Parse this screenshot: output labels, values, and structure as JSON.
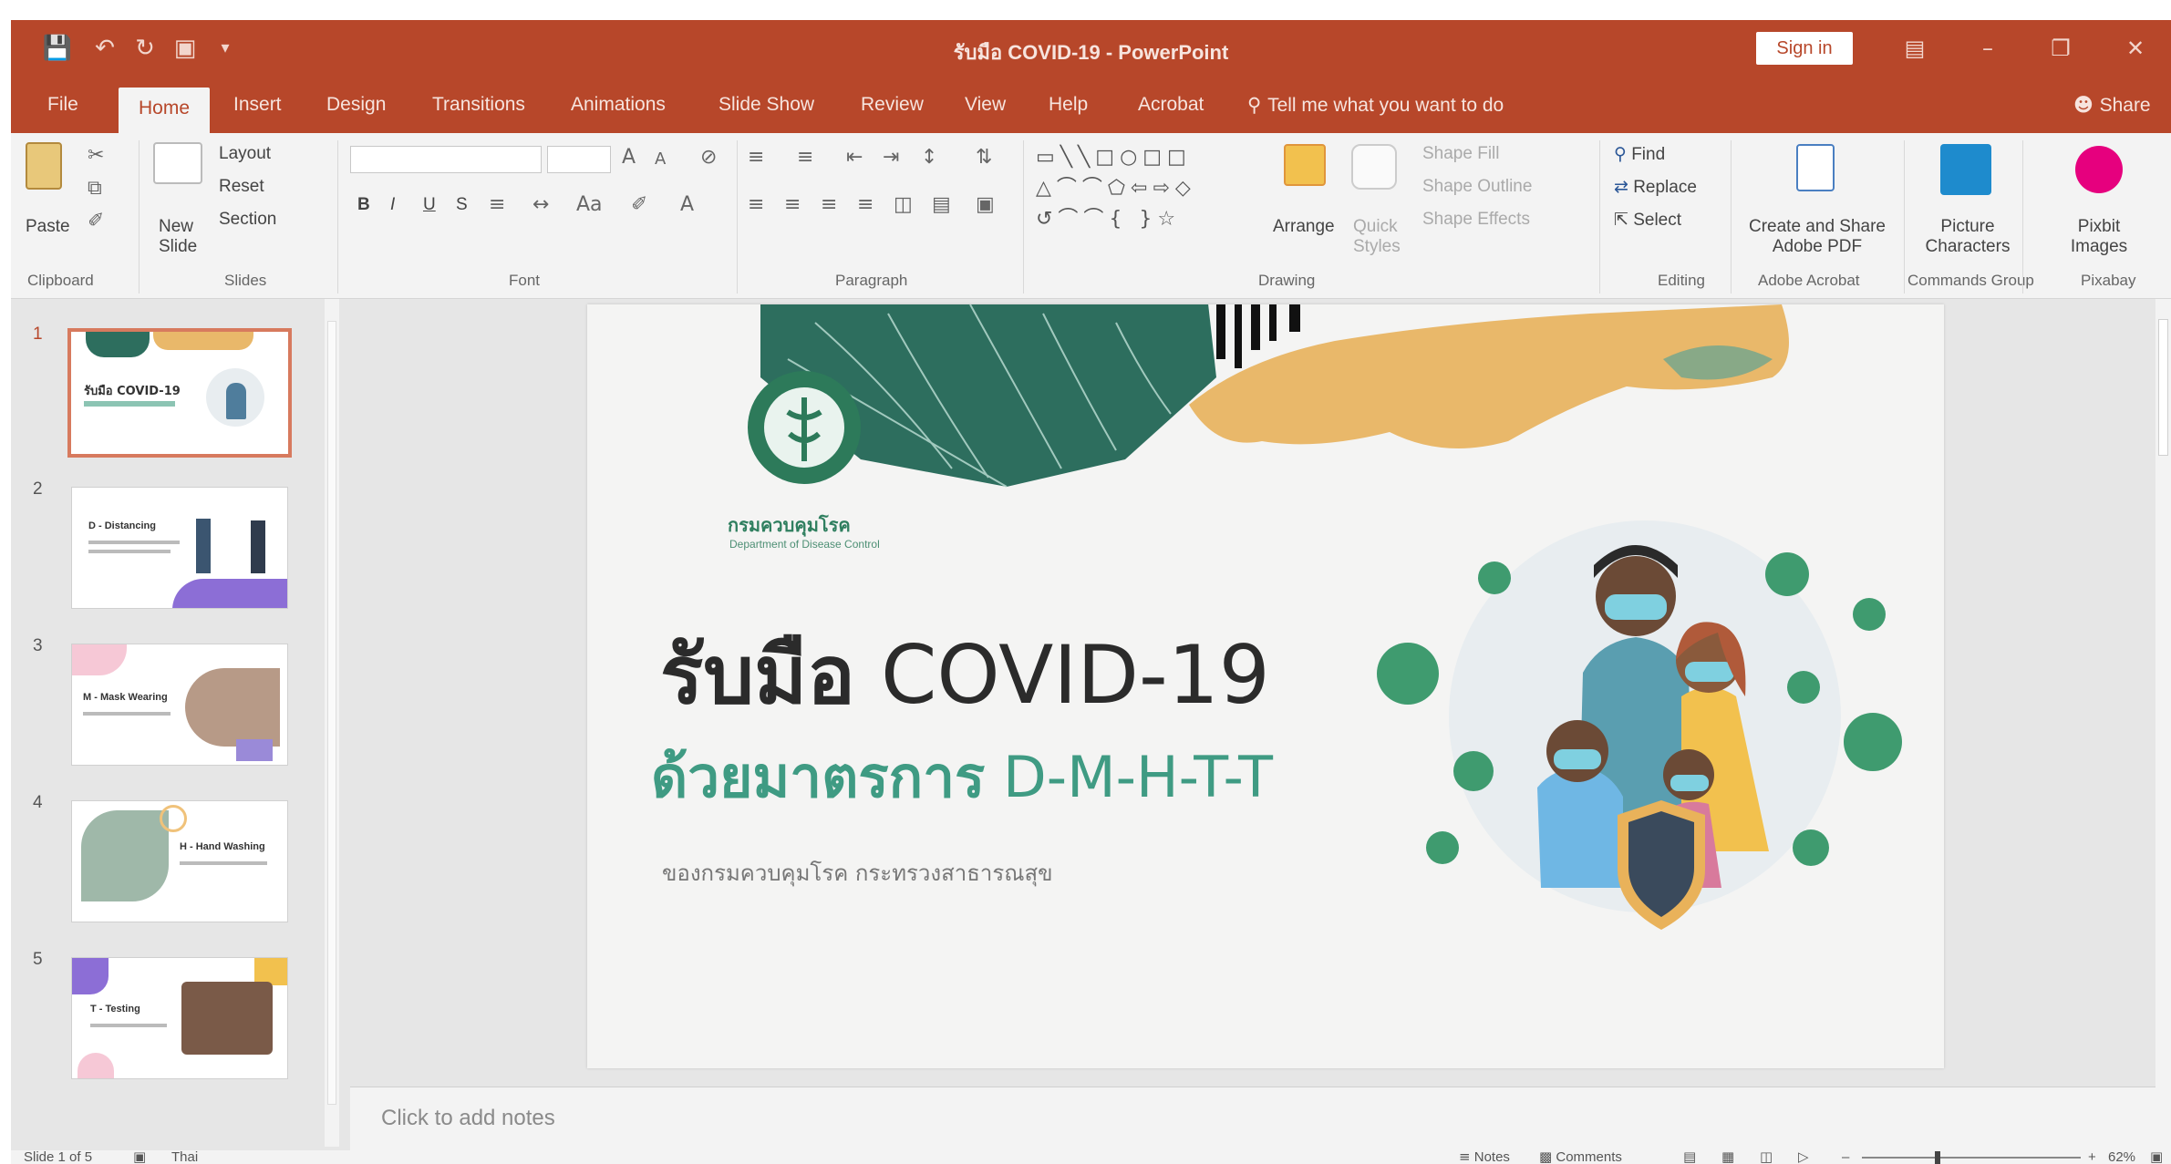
{
  "window": {
    "title": "รับมือ COVID-19 - PowerPoint",
    "sign_in": "Sign in",
    "qat_icons": [
      "save-icon",
      "undo-icon",
      "redo-icon",
      "start-from-beginning-icon",
      "customize-qat-icon"
    ]
  },
  "tabs": [
    {
      "label": "File"
    },
    {
      "label": "Home"
    },
    {
      "label": "Insert"
    },
    {
      "label": "Design"
    },
    {
      "label": "Transitions"
    },
    {
      "label": "Animations"
    },
    {
      "label": "Slide Show"
    },
    {
      "label": "Review"
    },
    {
      "label": "View"
    },
    {
      "label": "Help"
    },
    {
      "label": "Acrobat"
    }
  ],
  "tell_me": "Tell me what you want to do",
  "share": "Share",
  "ribbon": {
    "clipboard": {
      "label": "Clipboard",
      "paste": "Paste"
    },
    "slides": {
      "label": "Slides",
      "new_slide": "New Slide",
      "layout": "Layout",
      "reset": "Reset",
      "section": "Section"
    },
    "font": {
      "label": "Font",
      "bold": "B",
      "italic": "I",
      "underline": "U",
      "shadow": "S"
    },
    "paragraph": {
      "label": "Paragraph"
    },
    "drawing": {
      "label": "Drawing",
      "arrange": "Arrange",
      "quick_styles": "Quick Styles",
      "shape_fill": "Shape Fill",
      "shape_outline": "Shape Outline",
      "shape_effects": "Shape Effects"
    },
    "editing": {
      "label": "Editing",
      "find": "Find",
      "replace": "Replace",
      "select": "Select"
    },
    "adobe": {
      "label": "Adobe Acrobat",
      "create_share": "Create and Share Adobe PDF"
    },
    "commands_group": {
      "label": "Commands Group",
      "picture_characters": "Picture Characters"
    },
    "pixabay": {
      "label": "Pixabay",
      "pixabay_images": "Pixbit Images"
    }
  },
  "thumbnails": [
    {
      "num": "1",
      "title": "รับมือ COVID-19"
    },
    {
      "num": "2",
      "title": "D - Distancing"
    },
    {
      "num": "3",
      "title": "M - Mask Wearing"
    },
    {
      "num": "4",
      "title": "H - Hand Washing"
    },
    {
      "num": "5",
      "title": "T - Testing"
    }
  ],
  "slide": {
    "title_thai": "รับมือ",
    "title_latin": " COVID-19",
    "subtitle_thai": "ด้วยมาตรการ",
    "subtitle_latin": " D-M-H-T-T",
    "caption": "ของกรมควบคุมโรค กระทรวงสาธารณสุข",
    "dept_name": "กรมควบคุมโรค",
    "dept_name_en": "Department of Disease Control"
  },
  "notes_placeholder": "Click to add notes",
  "status": {
    "slide_info": "Slide 1 of 5",
    "language": "Thai",
    "notes": "Notes",
    "comments": "Comments",
    "zoom": "62%"
  },
  "colors": {
    "accent": "#b7472a",
    "slide_green": "#3f9b83",
    "dark_green": "#2d6e5e",
    "sand": "#e9b86a"
  }
}
